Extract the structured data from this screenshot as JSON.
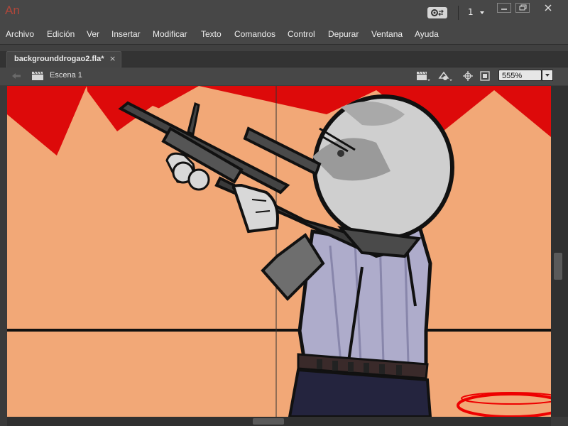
{
  "app": {
    "logo": "An"
  },
  "workspace": {
    "frame_number": "1",
    "switcher_icon": "workspace-switch-icon"
  },
  "window_controls": {
    "minimize": "minimize-icon",
    "restore": "restore-icon",
    "close": "close-icon"
  },
  "menu": {
    "items": [
      "Archivo",
      "Edición",
      "Ver",
      "Insertar",
      "Modificar",
      "Texto",
      "Comandos",
      "Control",
      "Depurar",
      "Ventana",
      "Ayuda"
    ]
  },
  "document": {
    "tab_label": "backgrounddrogao2.fla*",
    "close_glyph": "×"
  },
  "edit_bar": {
    "scene_label": "Escena 1",
    "zoom_value": "555%"
  },
  "colors": {
    "background_red": "#dd0a0a",
    "stage_skin": "#f2a877",
    "head_gray": "#cfcfcf",
    "shirt_lavender": "#a8a6c8",
    "pants_navy": "#24243e"
  }
}
